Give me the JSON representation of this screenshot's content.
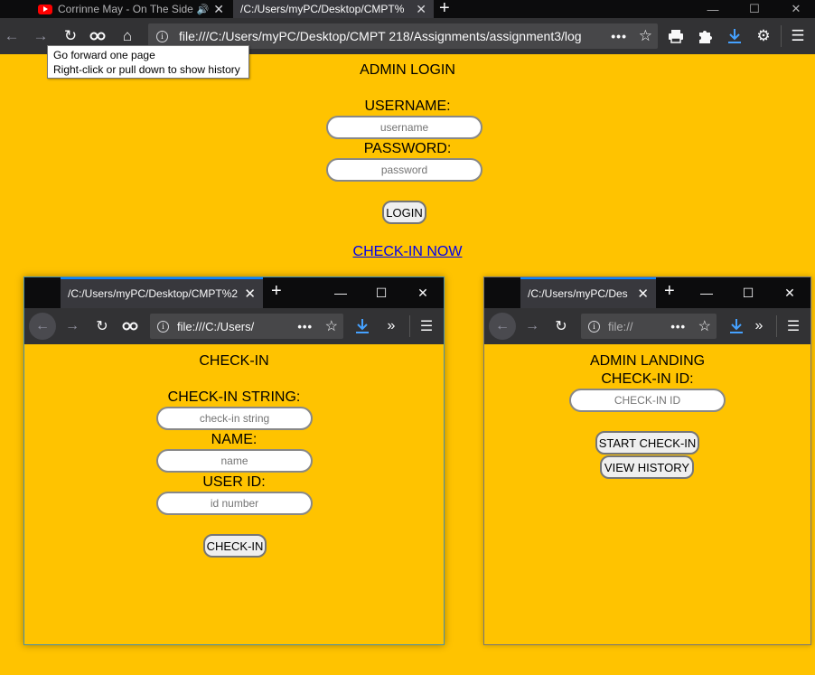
{
  "browser": {
    "tabs": [
      {
        "title": "Corrinne May - On The Side"
      },
      {
        "title": "/C:/Users/myPC/Desktop/CMPT%"
      }
    ],
    "url": "file:///C:/Users/myPC/Desktop/CMPT 218/Assignments/assignment3/log",
    "tooltip": {
      "line1": "Go forward one page",
      "line2": "Right-click or pull down to show history"
    },
    "icons": [
      "back-icon",
      "forward-icon",
      "reload-icon",
      "private-mask-icon",
      "home-icon",
      "info-icon",
      "more-dots-icon",
      "bookmark-star-icon",
      "print-icon",
      "extensions-icon",
      "download-icon",
      "settings-gear-icon",
      "menu-icon"
    ],
    "download_color": "#45a1ff"
  },
  "login_page": {
    "heading": "ADMIN LOGIN",
    "username_label": "USERNAME:",
    "username_placeholder": "username",
    "password_label": "PASSWORD:",
    "password_placeholder": "password",
    "login_button": "LOGIN",
    "checkin_link": "CHECK-IN NOW"
  },
  "checkin_window": {
    "tab_title": "/C:/Users/myPC/Desktop/CMPT%2",
    "url": "file:///C:/Users/",
    "heading": "CHECK-IN",
    "string_label": "CHECK-IN STRING:",
    "string_placeholder": "check-in string",
    "name_label": "NAME:",
    "name_placeholder": "name",
    "userid_label": "USER ID:",
    "userid_placeholder": "id number",
    "checkin_button": "CHECK-IN"
  },
  "admin_window": {
    "tab_title": "/C:/Users/myPC/Des",
    "url": "file://",
    "heading": "ADMIN LANDING",
    "checkin_id_label": "CHECK-IN ID:",
    "checkin_id_placeholder": "CHECK-IN ID",
    "start_button": "START CHECK-IN",
    "history_button": "VIEW HISTORY"
  },
  "colors": {
    "page_bg": "#FFC300",
    "chrome_dark": "#0c0c0d",
    "toolbar": "#323234",
    "link": "#0000ee"
  }
}
